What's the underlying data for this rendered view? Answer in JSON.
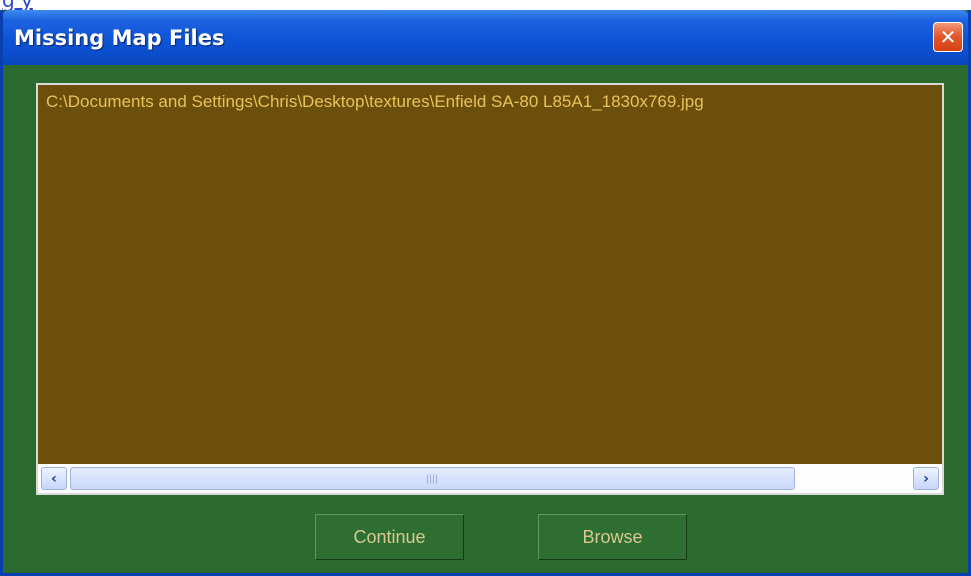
{
  "window": {
    "title": "Missing Map Files",
    "close_glyph": "✕"
  },
  "top_strip": {
    "text": "g y"
  },
  "file_list": {
    "items": [
      "C:\\Documents and Settings\\Chris\\Desktop\\textures\\Enfield SA-80 L85A1_1830x769.jpg"
    ]
  },
  "scrollbar": {
    "left_arrow": "‹",
    "right_arrow": "›"
  },
  "buttons": {
    "continue_label": "Continue",
    "browse_label": "Browse"
  },
  "colors": {
    "title_bar": "#0f55d8",
    "dialog_background": "#2a6a2f",
    "list_background": "#6c4f0a",
    "list_text": "#e6c35a",
    "button_text": "#d7c98f",
    "close_button": "#e4582f"
  }
}
